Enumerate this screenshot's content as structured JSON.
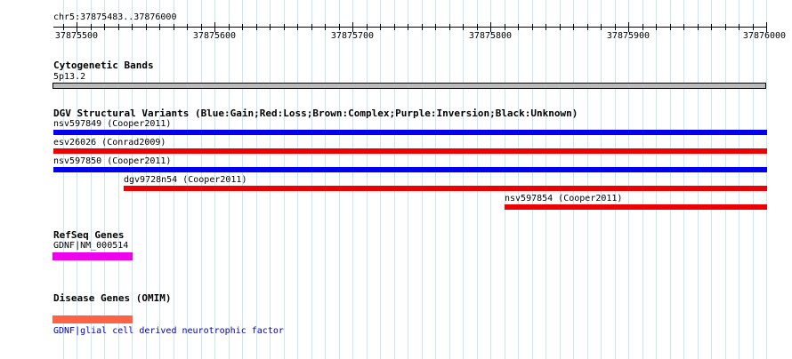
{
  "region": {
    "label": "chr5:37875483..37876000",
    "start": 37875483,
    "end": 37876000
  },
  "ruler": {
    "ticks": [
      "37875500",
      "37875600",
      "37875700",
      "37875800",
      "37875900",
      "37876000"
    ]
  },
  "cytogenetic": {
    "title": "Cytogenetic Bands",
    "band": "5p13.2",
    "color": "#bbbbbb"
  },
  "dgv": {
    "title": "DGV Structural Variants (Blue:Gain;Red:Loss;Brown:Complex;Purple:Inversion;Black:Unknown)",
    "colors": {
      "gain": "#0000ee",
      "loss": "#ee0000"
    },
    "variants": [
      {
        "label": "nsv597849 (Cooper2011)",
        "type": "gain"
      },
      {
        "label": "esv26026 (Conrad2009)",
        "type": "loss"
      },
      {
        "label": "nsv597850 (Cooper2011)",
        "type": "gain"
      },
      {
        "label": "dgv9728n54 (Cooper2011)",
        "type": "loss"
      },
      {
        "label": "nsv597854 (Cooper2011)",
        "type": "loss"
      }
    ]
  },
  "refseq": {
    "title": "RefSeq Genes",
    "gene": "GDNF|NM_000514",
    "color": "#ee00ee"
  },
  "omim": {
    "title": "Disease Genes (OMIM)",
    "gene": "GDNF|glial cell derived neurotrophic factor",
    "color": "#ff6347"
  }
}
